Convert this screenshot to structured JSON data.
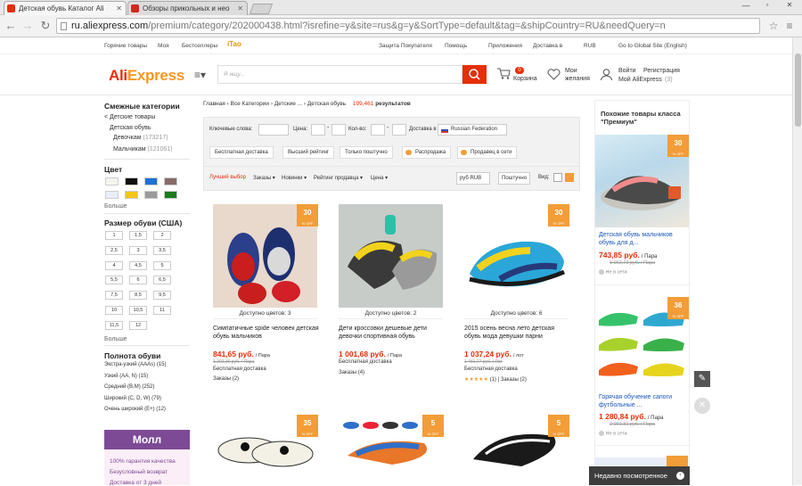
{
  "browser": {
    "tabs": [
      {
        "label": "Детская обувь Каталог Ali",
        "active": true
      },
      {
        "label": "Обзоры прикольных и нео",
        "active": false
      }
    ],
    "url_domain": "ru.aliexpress.com",
    "url_rest": "/premium/category/202000438.html?isrefine=y&site=rus&g=y&SortType=default&tag=&shipCountry=RU&needQuery=n"
  },
  "topnav": {
    "left": [
      "Горячие товары",
      "Моя",
      "Бестселлеры",
      "iTao"
    ],
    "right": [
      "Защита Покупателя",
      "Помощь",
      "Приложения",
      "Доставка в",
      "RUB",
      "Go to Global Site (English)"
    ]
  },
  "header": {
    "logo_a": "Ali",
    "logo_b": "Express",
    "search_placeholder": "Я ищу...",
    "cart_count": "0",
    "cart_label": "Корзина",
    "wish_label1": "Мои",
    "wish_label2": "желания",
    "login": "Войти",
    "register": "Регистрация",
    "myali": "Мой AliExpress",
    "myali_count": "(3)"
  },
  "sidebar": {
    "related_title": "Смежные категории",
    "related": [
      {
        "label": "< Детские товары",
        "indent": 0
      },
      {
        "label": "Детская обувь",
        "indent": 6
      },
      {
        "label": "Девочкам",
        "count": "(173217)",
        "indent": 10
      },
      {
        "label": "Мальчикам",
        "count": "(121061)",
        "indent": 10
      }
    ],
    "color_title": "Цвет",
    "colors": [
      "#f5f5ef",
      "#111111",
      "#1e6fd9",
      "#8a6a6a",
      "#e8eef8",
      "#f5c518",
      "#9a9a9a",
      "#1e7b1e"
    ],
    "more": "Больше",
    "size_title": "Размер обуви (США)",
    "sizes": [
      "1",
      "1,5",
      "2",
      "2,5",
      "3",
      "3,5",
      "4",
      "4,5",
      "5",
      "5,5",
      "6",
      "6,5",
      "7,5",
      "8,5",
      "9,5",
      "10",
      "10,5",
      "11",
      "11,5",
      "12"
    ],
    "width_title": "Полнота обуви",
    "widths": [
      "Экстра-узкий (AAAs) (15)",
      "Узкий (AA, N) (15)",
      "Средний (B,M) (252)",
      "Широкий (C, D, W) (79)",
      "Очень широкий (E+) (12)"
    ],
    "mall_title": "Молл",
    "mall_lines": [
      "100% гарантия качества",
      "Безусловный возврат",
      "Доставка от 3 дней"
    ]
  },
  "main": {
    "breadcrumb": [
      "Главная",
      "Все Категории",
      "Детские ...",
      "Детская обувь"
    ],
    "result_count": "199,461",
    "result_label": "результатов",
    "filter": {
      "keywords": "Ключевые слова:",
      "price": "Цена:",
      "qty": "Кол-во:",
      "ship": "Доставка в",
      "country": "Russian Federation"
    },
    "buttons": [
      "Бесплатная доставка",
      "Высший рейтинг",
      "Только поштучно",
      "Распродажа",
      "Продавец в сети"
    ],
    "sort": [
      "Лучший выбор",
      "Заказы",
      "Новинки",
      "Рейтинг продавца",
      "Цена"
    ],
    "currency": "руб RUB",
    "unit": "Поштучно",
    "view": "Вид:",
    "products": [
      {
        "badge": "30",
        "colors": "Доступно цветов: 3",
        "title": "Симпатичные spide человек детская обувь мальчиков",
        "price": "841,65 руб.",
        "per": "/ Пара",
        "old": "1 202,36 руб. / Пара",
        "ship": "Бесплатная доставка",
        "orders": "Заказы (2)"
      },
      {
        "badge": "",
        "colors": "Доступно цветов: 2",
        "title": "Дети кроссовки дешевые дети девочки спортивная обувь",
        "price": "1 001,68 руб.",
        "per": "/ Пара",
        "old": "",
        "ship": "Бесплатная доставка",
        "orders": "Заказы (4)"
      },
      {
        "badge": "30",
        "colors": "Доступно цветов: 6",
        "title": "2015 осень весна лето детская обувь мода девушки парни",
        "price": "1 037,24 руб.",
        "per": "/ лот",
        "old": "1 481,77 руб. / Лот",
        "ship": "Бесплатная доставка",
        "orders": "(1) | Заказы (2)"
      },
      {
        "badge": "35",
        "colors": "",
        "title": "",
        "price": "",
        "per": "",
        "old": "",
        "ship": "",
        "orders": ""
      },
      {
        "badge": "5",
        "colors": "",
        "title": "",
        "price": "",
        "per": "",
        "old": "",
        "ship": "",
        "orders": ""
      },
      {
        "badge": "5",
        "colors": "",
        "title": "",
        "price": "",
        "per": "",
        "old": "",
        "ship": "",
        "orders": ""
      }
    ]
  },
  "right": {
    "title": "Похожие товары класса \"Премиум\"",
    "items": [
      {
        "badge": "30",
        "title": "Детская обувь мальчиков обувь для д...",
        "price": "743,85 руб.",
        "per": "/ Пара",
        "old": "1 062,72 руб. / Пара",
        "status": "Не в сети"
      },
      {
        "badge": "36",
        "title": "Горячая обучение сапоги футбольные ...",
        "price": "1 280,84 руб.",
        "per": "/ Пара",
        "old": "2 001,31 руб. / Пара",
        "status": "Не в сети"
      }
    ],
    "recent": "Недавно посмотренное"
  },
  "styles": {
    "accent": "#e62e04",
    "orange": "#f29d38",
    "link": "#333333"
  }
}
